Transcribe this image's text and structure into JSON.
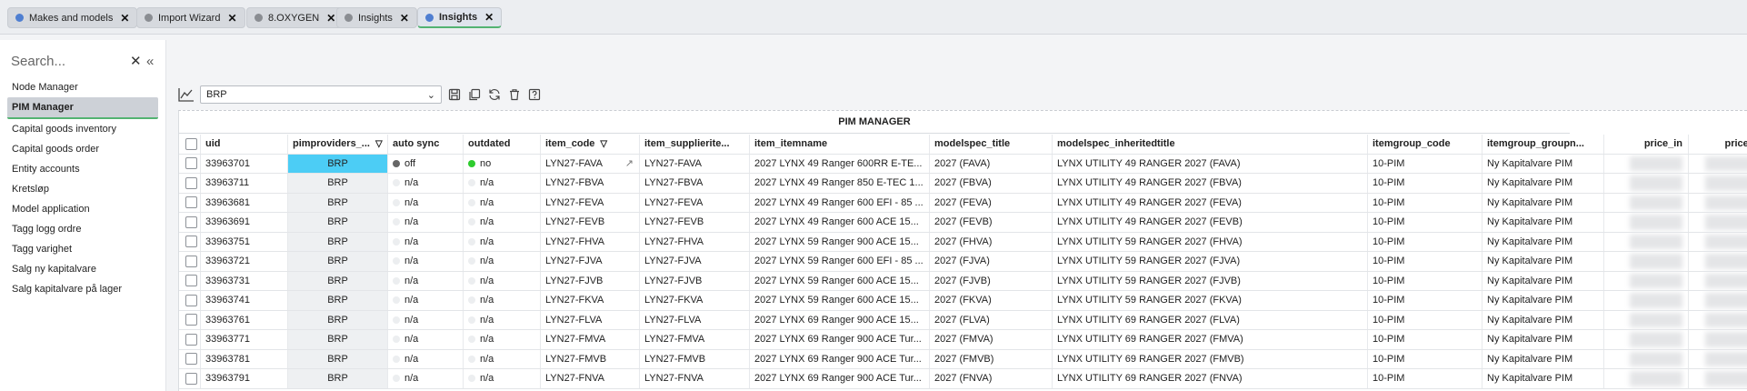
{
  "tabs": [
    {
      "label": "Makes and models",
      "dot": "blue"
    },
    {
      "label": "Import Wizard",
      "dot": "gray"
    },
    {
      "label": "8.OXYGEN",
      "dot": "gray"
    },
    {
      "label": "Insights",
      "dot": "gray"
    },
    {
      "label": "Insights",
      "dot": "blue",
      "active": true
    }
  ],
  "sidebar": {
    "search_placeholder": "Search...",
    "items": [
      "Node Manager",
      "PIM Manager",
      "Capital goods inventory",
      "Capital goods order",
      "Entity accounts",
      "Kretsløp",
      "Model application",
      "Tagg logg ordre",
      "Tagg varighet",
      "Salg ny kapitalvare",
      "Salg kapitalvare på lager"
    ],
    "active_index": 1
  },
  "toolbar": {
    "select_value": "BRP"
  },
  "grid": {
    "title": "PIM MANAGER",
    "columns": [
      "uid",
      "pimproviders_...",
      "auto sync",
      "outdated",
      "item_code",
      "item_supplierite...",
      "item_itemname",
      "modelspec_title",
      "modelspec_inheritedtitle",
      "itemgroup_code",
      "itemgroup_groupn...",
      "price_in",
      "price_out"
    ],
    "rows": [
      [
        "33963701",
        "BRP",
        "off",
        "no",
        "LYN27-FAVA",
        "LYN27-FAVA",
        "2027 LYNX 49 Ranger 600RR E-TE...",
        "2027 (FAVA)",
        "LYNX UTILITY 49 RANGER 2027 (FAVA)",
        "10-PIM",
        "Ny Kapitalvare PIM"
      ],
      [
        "33963711",
        "BRP",
        "n/a",
        "n/a",
        "LYN27-FBVA",
        "LYN27-FBVA",
        "2027 LYNX 49 Ranger 850 E-TEC 1...",
        "2027 (FBVA)",
        "LYNX UTILITY 49 RANGER 2027 (FBVA)",
        "10-PIM",
        "Ny Kapitalvare PIM"
      ],
      [
        "33963681",
        "BRP",
        "n/a",
        "n/a",
        "LYN27-FEVA",
        "LYN27-FEVA",
        "2027 LYNX 49 Ranger 600 EFI - 85 ...",
        "2027 (FEVA)",
        "LYNX UTILITY 49 RANGER 2027 (FEVA)",
        "10-PIM",
        "Ny Kapitalvare PIM"
      ],
      [
        "33963691",
        "BRP",
        "n/a",
        "n/a",
        "LYN27-FEVB",
        "LYN27-FEVB",
        "2027 LYNX 49 Ranger 600 ACE 15...",
        "2027 (FEVB)",
        "LYNX UTILITY 49 RANGER 2027 (FEVB)",
        "10-PIM",
        "Ny Kapitalvare PIM"
      ],
      [
        "33963751",
        "BRP",
        "n/a",
        "n/a",
        "LYN27-FHVA",
        "LYN27-FHVA",
        "2027 LYNX 59 Ranger 900 ACE 15...",
        "2027 (FHVA)",
        "LYNX UTILITY 59 RANGER 2027 (FHVA)",
        "10-PIM",
        "Ny Kapitalvare PIM"
      ],
      [
        "33963721",
        "BRP",
        "n/a",
        "n/a",
        "LYN27-FJVA",
        "LYN27-FJVA",
        "2027 LYNX 59 Ranger 600 EFI - 85 ...",
        "2027 (FJVA)",
        "LYNX UTILITY 59 RANGER 2027 (FJVA)",
        "10-PIM",
        "Ny Kapitalvare PIM"
      ],
      [
        "33963731",
        "BRP",
        "n/a",
        "n/a",
        "LYN27-FJVB",
        "LYN27-FJVB",
        "2027 LYNX 59 Ranger 600 ACE 15...",
        "2027 (FJVB)",
        "LYNX UTILITY 59 RANGER 2027 (FJVB)",
        "10-PIM",
        "Ny Kapitalvare PIM"
      ],
      [
        "33963741",
        "BRP",
        "n/a",
        "n/a",
        "LYN27-FKVA",
        "LYN27-FKVA",
        "2027 LYNX 59 Ranger 600 ACE 15...",
        "2027 (FKVA)",
        "LYNX UTILITY 59 RANGER 2027 (FKVA)",
        "10-PIM",
        "Ny Kapitalvare PIM"
      ],
      [
        "33963761",
        "BRP",
        "n/a",
        "n/a",
        "LYN27-FLVA",
        "LYN27-FLVA",
        "2027 LYNX 69 Ranger 900 ACE 15...",
        "2027 (FLVA)",
        "LYNX UTILITY 69 RANGER 2027 (FLVA)",
        "10-PIM",
        "Ny Kapitalvare PIM"
      ],
      [
        "33963771",
        "BRP",
        "n/a",
        "n/a",
        "LYN27-FMVA",
        "LYN27-FMVA",
        "2027 LYNX 69 Ranger 900 ACE Tur...",
        "2027 (FMVA)",
        "LYNX UTILITY 69 RANGER 2027 (FMVA)",
        "10-PIM",
        "Ny Kapitalvare PIM"
      ],
      [
        "33963781",
        "BRP",
        "n/a",
        "n/a",
        "LYN27-FMVB",
        "LYN27-FMVB",
        "2027 LYNX 69 Ranger 900 ACE Tur...",
        "2027 (FMVB)",
        "LYNX UTILITY 69 RANGER 2027 (FMVB)",
        "10-PIM",
        "Ny Kapitalvare PIM"
      ],
      [
        "33963791",
        "BRP",
        "n/a",
        "n/a",
        "LYN27-FNVA",
        "LYN27-FNVA",
        "2027 LYNX 69 Ranger 900 ACE Tur...",
        "2027 (FNVA)",
        "LYNX UTILITY 69 RANGER 2027 (FNVA)",
        "10-PIM",
        "Ny Kapitalvare PIM"
      ]
    ],
    "selected_provider_row": 0,
    "status_colors": {
      "off": "#666666",
      "no": "#2ecc2e",
      "provider_selected": "#4ccdf5",
      "accent": "#53b372"
    }
  }
}
